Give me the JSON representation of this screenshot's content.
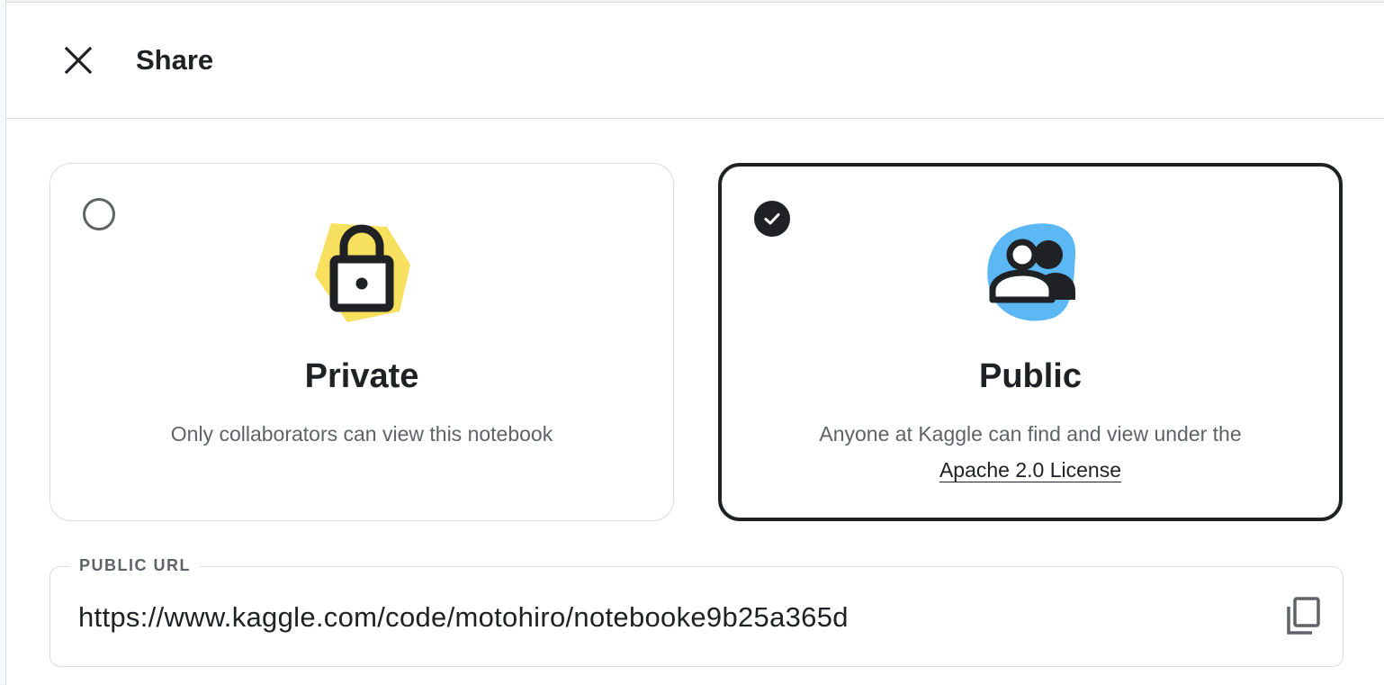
{
  "header": {
    "title": "Share",
    "close_icon": "close-icon"
  },
  "options": {
    "private": {
      "label": "Private",
      "description": "Only collaborators can view this notebook",
      "selected": false,
      "icon": "lock-icon",
      "icon_color": "#f6e05e"
    },
    "public": {
      "label": "Public",
      "description": "Anyone at Kaggle can find and view under the",
      "license_link": "Apache 2.0 License",
      "selected": true,
      "icon": "people-icon",
      "icon_color": "#5bb8f5"
    }
  },
  "public_url": {
    "label": "PUBLIC URL",
    "value": "https://www.kaggle.com/code/motohiro/notebooke9b25a365d",
    "copy_icon": "copy-icon"
  },
  "colors": {
    "text_primary": "#202124",
    "text_secondary": "#5f6368",
    "border": "#dadce0",
    "selected_border": "#202124"
  }
}
